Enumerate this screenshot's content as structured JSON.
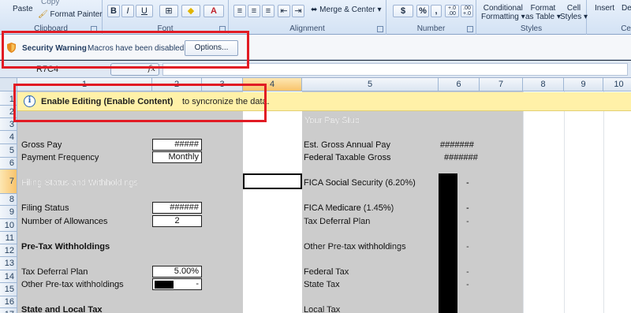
{
  "ribbon": {
    "clipboard": {
      "paste": "Paste",
      "copy": "Copy",
      "format_painter": "Format Painter",
      "label": "Clipboard"
    },
    "font": {
      "bold": "B",
      "italic": "I",
      "underline": "U",
      "font_color": "A",
      "label": "Font"
    },
    "alignment": {
      "merge_center": "Merge & Center",
      "label": "Alignment"
    },
    "number": {
      "currency": "$",
      "percent": "%",
      "comma": ",",
      "inc_decimal": "+.0 .00",
      "dec_decimal": ".00 +.0",
      "label": "Number"
    },
    "styles": {
      "conditional": "Conditional",
      "formatting": "Formatting",
      "format": "Format",
      "as_table": "as Table",
      "cell": "Cell",
      "cell_styles": "Styles",
      "label": "Styles"
    },
    "cells": {
      "insert": "Insert",
      "delete": "De",
      "label": "Ce"
    }
  },
  "security_bar": {
    "title": "Security Warning",
    "message": "Macros have been disabled.",
    "options_button": "Options..."
  },
  "formula_bar": {
    "name_box": "R7C4",
    "fx": "fx",
    "value": ""
  },
  "enable_bar": {
    "bold_text": "Enable Editing (Enable Content)",
    "rest_text": "to syncronize the data."
  },
  "columns": [
    "1",
    "2",
    "3",
    "4",
    "5",
    "6",
    "7",
    "8",
    "9",
    "10"
  ],
  "rows": [
    "1",
    "2",
    "3",
    "4",
    "5",
    "6",
    "7",
    "8",
    "9",
    "10",
    "11",
    "12",
    "13",
    "14",
    "15",
    "16",
    "17"
  ],
  "sheet": {
    "gross_pay_label": "Gross Pay",
    "gross_pay_value": "#####",
    "payment_frequency_label": "Payment Frequency",
    "payment_frequency_value": "Monthly",
    "filing_heading_ghost": "Filing Status and Withholdings",
    "filing_status_label": "Filing Status",
    "filing_status_value": "######",
    "allowances_label": "Number of Allowances",
    "allowances_value": "2",
    "pretax_heading": "Pre-Tax Withholdings",
    "tax_deferral_label": "Tax Deferral Plan",
    "tax_deferral_value": "5.00%",
    "other_pretax_label": "Other Pre-tax withholdings",
    "other_pretax_value": "-",
    "state_local_heading": "State and Local Tax",
    "pay_stub_ghost": "Your Pay Stub",
    "est_gross_label": "Est. Gross Annual Pay",
    "est_gross_value": "#######",
    "fed_taxable_label": "Federal Taxable Gross",
    "fed_taxable_value": "#######",
    "fica_ss_label": "FICA Social Security (6.20%)",
    "fica_medicare_label": "FICA Medicare (1.45%)",
    "tax_deferral_plan_label": "Tax Deferral Plan",
    "other_pretax_withholdings_label": "Other Pre-tax withholdings",
    "federal_tax_label": "Federal Tax",
    "state_tax_label": "State Tax",
    "local_tax_label": "Local Tax",
    "dash": "-"
  }
}
